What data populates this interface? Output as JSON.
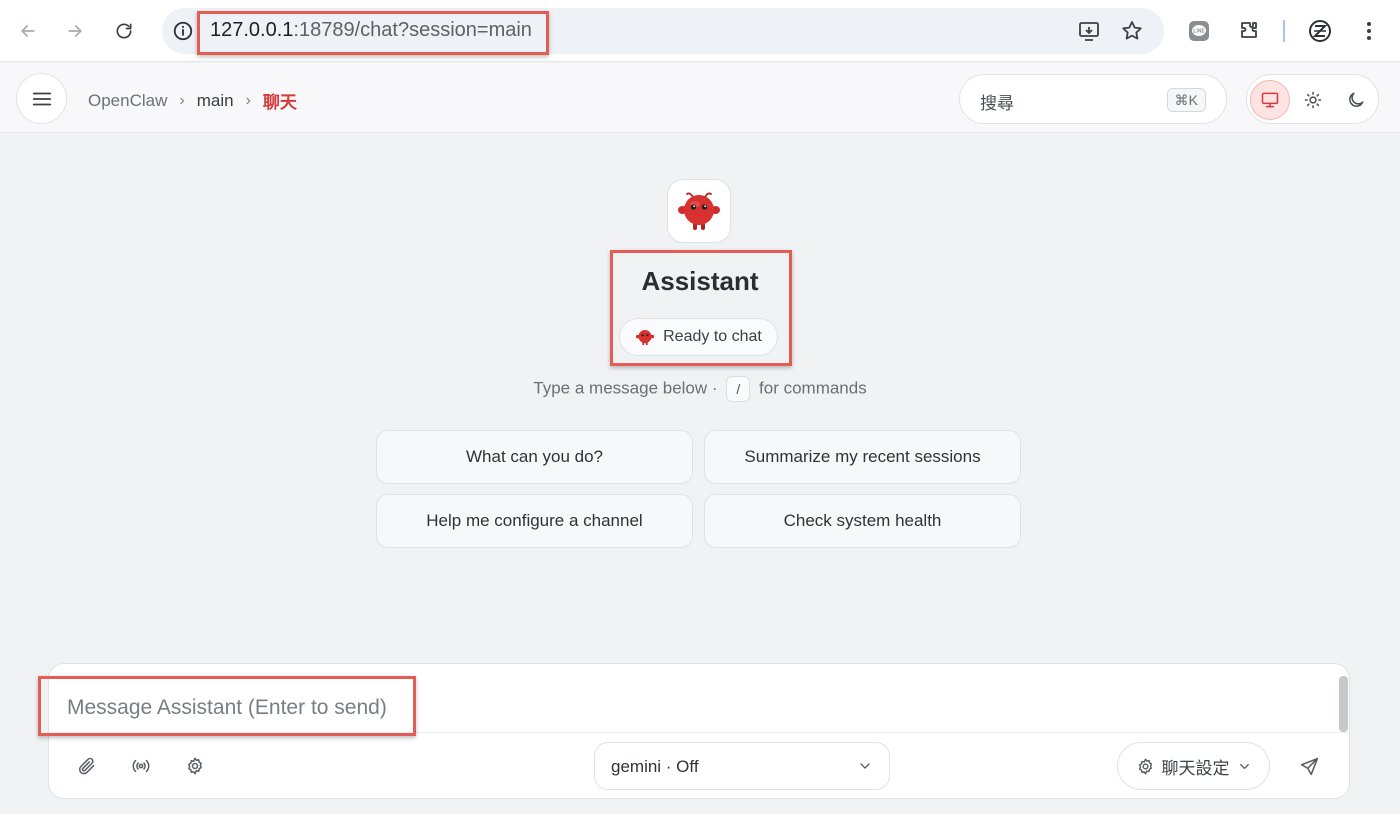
{
  "browser": {
    "url_host": "127.0.0.1",
    "url_rest": ":18789/chat?session=main"
  },
  "header": {
    "breadcrumb": {
      "root": "OpenClaw",
      "separator": "›",
      "session": "main",
      "current": "聊天"
    },
    "search": {
      "label": "搜尋",
      "shortcut": "⌘K"
    },
    "theme": {
      "options": [
        "system",
        "light",
        "dark"
      ],
      "active": "system"
    }
  },
  "welcome": {
    "assistant_name": "Assistant",
    "status": "Ready to chat",
    "hint_prefix": "Type a message below ·",
    "hint_key": "/",
    "hint_suffix": "for commands"
  },
  "suggestions": [
    "What can you do?",
    "Summarize my recent sessions",
    "Help me configure a channel",
    "Check system health"
  ],
  "composer": {
    "placeholder": "Message Assistant (Enter to send)",
    "model_label": "gemini · Off",
    "settings_label": "聊天設定"
  },
  "colors": {
    "accent": "#d63a3a",
    "annotation": "#e35d55",
    "background": "#f1f2f4"
  }
}
